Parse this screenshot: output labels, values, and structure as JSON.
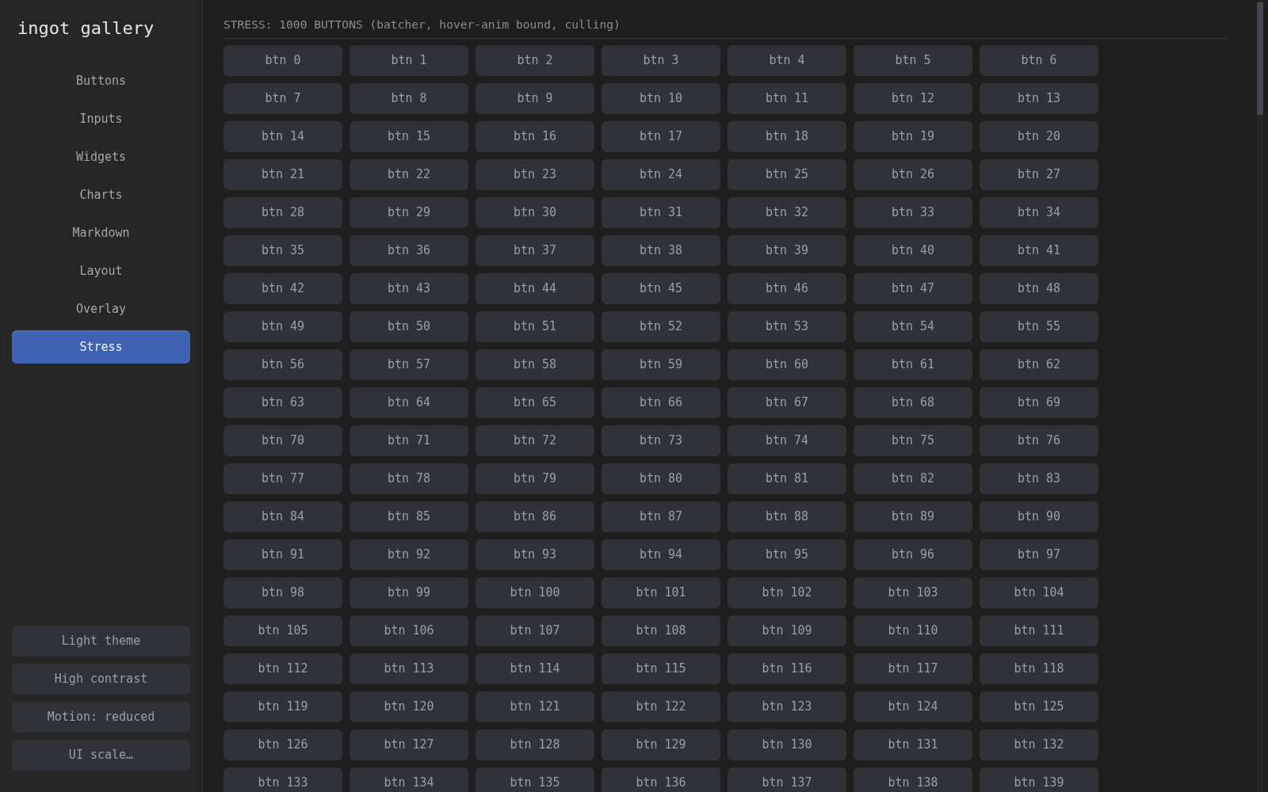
{
  "sidebar": {
    "title": "ingot gallery",
    "nav_items": [
      {
        "label": "Buttons",
        "selected": false
      },
      {
        "label": "Inputs",
        "selected": false
      },
      {
        "label": "Widgets",
        "selected": false
      },
      {
        "label": "Charts",
        "selected": false
      },
      {
        "label": "Markdown",
        "selected": false
      },
      {
        "label": "Layout",
        "selected": false
      },
      {
        "label": "Overlay",
        "selected": false
      },
      {
        "label": "Stress",
        "selected": true
      }
    ],
    "footer_buttons": [
      "Light theme",
      "High contrast",
      "Motion: reduced",
      "UI scale…"
    ]
  },
  "main": {
    "heading": "STRESS: 1000 BUTTONS (batcher, hover-anim bound, culling)",
    "buttons": [
      "btn 0",
      "btn 1",
      "btn 2",
      "btn 3",
      "btn 4",
      "btn 5",
      "btn 6",
      "btn 7",
      "btn 8",
      "btn 9",
      "btn 10",
      "btn 11",
      "btn 12",
      "btn 13",
      "btn 14",
      "btn 15",
      "btn 16",
      "btn 17",
      "btn 18",
      "btn 19",
      "btn 20",
      "btn 21",
      "btn 22",
      "btn 23",
      "btn 24",
      "btn 25",
      "btn 26",
      "btn 27",
      "btn 28",
      "btn 29",
      "btn 30",
      "btn 31",
      "btn 32",
      "btn 33",
      "btn 34",
      "btn 35",
      "btn 36",
      "btn 37",
      "btn 38",
      "btn 39",
      "btn 40",
      "btn 41",
      "btn 42",
      "btn 43",
      "btn 44",
      "btn 45",
      "btn 46",
      "btn 47",
      "btn 48",
      "btn 49",
      "btn 50",
      "btn 51",
      "btn 52",
      "btn 53",
      "btn 54",
      "btn 55",
      "btn 56",
      "btn 57",
      "btn 58",
      "btn 59",
      "btn 60",
      "btn 61",
      "btn 62",
      "btn 63",
      "btn 64",
      "btn 65",
      "btn 66",
      "btn 67",
      "btn 68",
      "btn 69",
      "btn 70",
      "btn 71",
      "btn 72",
      "btn 73",
      "btn 74",
      "btn 75",
      "btn 76",
      "btn 77",
      "btn 78",
      "btn 79",
      "btn 80",
      "btn 81",
      "btn 82",
      "btn 83",
      "btn 84",
      "btn 85",
      "btn 86",
      "btn 87",
      "btn 88",
      "btn 89",
      "btn 90",
      "btn 91",
      "btn 92",
      "btn 93",
      "btn 94",
      "btn 95",
      "btn 96",
      "btn 97",
      "btn 98",
      "btn 99",
      "btn 100",
      "btn 101",
      "btn 102",
      "btn 103",
      "btn 104",
      "btn 105",
      "btn 106",
      "btn 107",
      "btn 108",
      "btn 109",
      "btn 110",
      "btn 111",
      "btn 112",
      "btn 113",
      "btn 114",
      "btn 115",
      "btn 116",
      "btn 117",
      "btn 118",
      "btn 119",
      "btn 120",
      "btn 121",
      "btn 122",
      "btn 123",
      "btn 124",
      "btn 125",
      "btn 126",
      "btn 127",
      "btn 128",
      "btn 129",
      "btn 130",
      "btn 131",
      "btn 132",
      "btn 133",
      "btn 134",
      "btn 135",
      "btn 136",
      "btn 137",
      "btn 138",
      "btn 139"
    ]
  }
}
